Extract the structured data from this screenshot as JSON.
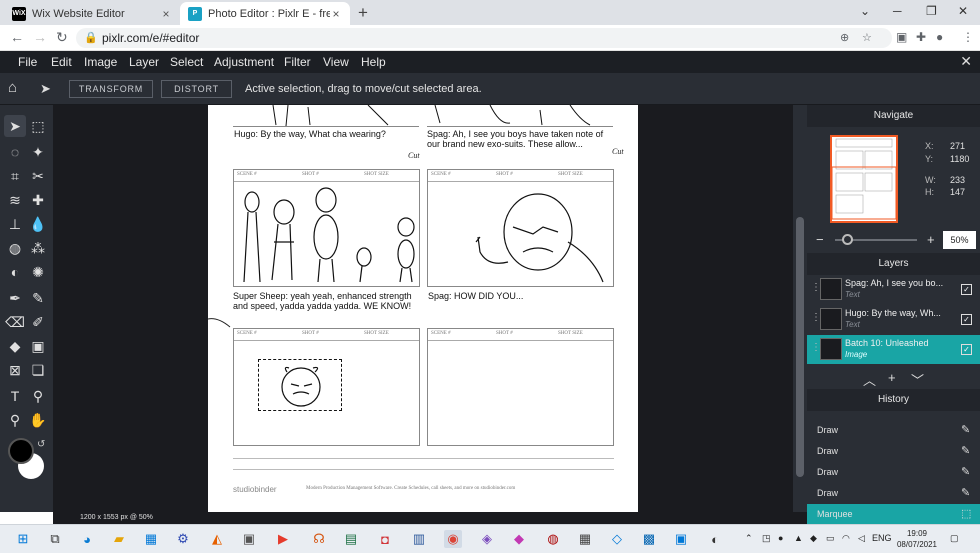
{
  "browser": {
    "tabs": [
      {
        "title": "Wix Website Editor",
        "favicon": "WiX",
        "active": false
      },
      {
        "title": "Photo Editor : Pixlr E - free image",
        "favicon": "P",
        "active": true
      }
    ],
    "new_tab": "+",
    "url": "pixlr.com/e/#editor"
  },
  "menu": {
    "items": [
      "File",
      "Edit",
      "Image",
      "Layer",
      "Select",
      "Adjustment",
      "Filter",
      "View",
      "Help"
    ]
  },
  "options": {
    "transform_label": "TRANSFORM",
    "distort_label": "DISTORT",
    "message": "Active selection, drag to move/cut selected area."
  },
  "document": {
    "caption_top_left": "Hugo: By the way, What cha wearing?",
    "caption_top_right": "Spag: Ah, I see you boys have taken note of our brand new exo-suits. These allow...",
    "caption_mid_left": "Super Sheep: yeah yeah, enhanced strength and speed, yadda yadda yadda. WE KNOW!",
    "caption_mid_right": "Spag: HOW DID YOU...",
    "cut_marks": [
      "Cut",
      "Cut"
    ],
    "frame_header": [
      "SCENE #",
      "SHOT #",
      "SHOT SIZE"
    ],
    "footer_brand": "studiobinder",
    "footer_text": "Modern Production Management Software. Create Schedules, call sheets, and more on studiobinder.com"
  },
  "status": {
    "dims": "1200 x 1553 px @ 50%"
  },
  "navigate": {
    "title": "Navigate",
    "x": "271",
    "y": "1180",
    "w": "233",
    "h": "147",
    "zoom": "50%",
    "labels": {
      "x": "X:",
      "y": "Y:",
      "w": "W:",
      "h": "H:"
    }
  },
  "layers": {
    "title": "Layers",
    "items": [
      {
        "name": "Spag: Ah, I see you bo...",
        "type": "Text",
        "active": false
      },
      {
        "name": "Hugo: By the way, Wh...",
        "type": "Text",
        "active": false
      },
      {
        "name": "Batch 10: Unleashed",
        "type": "Image",
        "active": true
      }
    ]
  },
  "history": {
    "title": "History",
    "items": [
      {
        "name": "Draw",
        "icon": "brush-icon"
      },
      {
        "name": "Draw",
        "icon": "brush-icon"
      },
      {
        "name": "Draw",
        "icon": "brush-icon"
      },
      {
        "name": "Draw",
        "icon": "brush-icon"
      },
      {
        "name": "Marquee",
        "icon": "marquee-icon",
        "active": true
      }
    ]
  },
  "taskbar": {
    "lang": "ENG",
    "time": "19:09",
    "date": "08/07/2021"
  },
  "colors": {
    "accent": "#19a5a5",
    "navigator_border": "#f15a24"
  }
}
